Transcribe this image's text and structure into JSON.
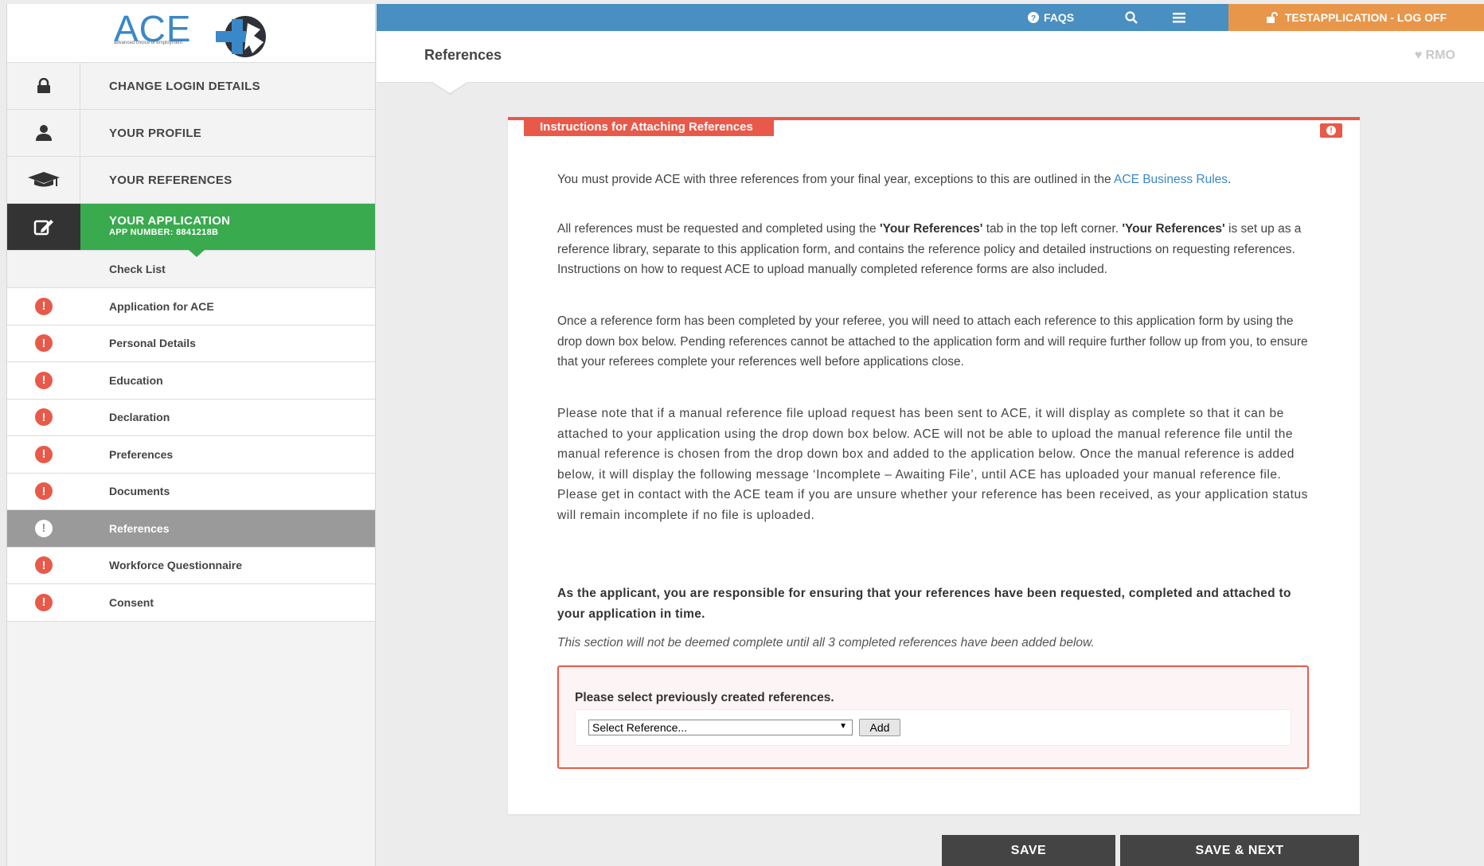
{
  "logo": {
    "text": "ACE",
    "tagline": "advanced choice of employment"
  },
  "sidebar": {
    "items": [
      {
        "label": "CHANGE LOGIN DETAILS",
        "icon": "lock-icon"
      },
      {
        "label": "YOUR PROFILE",
        "icon": "user-icon"
      },
      {
        "label": "YOUR REFERENCES",
        "icon": "graduation-cap-icon"
      },
      {
        "label": "YOUR APPLICATION",
        "sublabel": "APP NUMBER: 8841218B",
        "icon": "edit-icon"
      }
    ],
    "subitems": [
      {
        "label": "Check List",
        "status": ""
      },
      {
        "label": "Application for ACE",
        "status": "incomplete"
      },
      {
        "label": "Personal Details",
        "status": "incomplete"
      },
      {
        "label": "Education",
        "status": "incomplete"
      },
      {
        "label": "Declaration",
        "status": "incomplete"
      },
      {
        "label": "Preferences",
        "status": "incomplete"
      },
      {
        "label": "Documents",
        "status": "incomplete"
      },
      {
        "label": "References",
        "status": "incomplete"
      },
      {
        "label": "Workforce Questionnaire",
        "status": "incomplete"
      },
      {
        "label": "Consent",
        "status": "incomplete"
      }
    ],
    "alert_glyph": "!"
  },
  "topbar": {
    "faqs": "FAQS",
    "logoff": "TESTAPPLICATION - LOG OFF"
  },
  "header": {
    "title": "References",
    "rmo": "RMO"
  },
  "panel": {
    "title": "Instructions for Attaching References",
    "p1_a": "You must provide ACE with three references from your final year, exceptions to this are outlined in the ",
    "p1_link": "ACE Business Rules",
    "p1_b": ".",
    "p2_a": "All references must be requested and completed using the ",
    "p2_b1": "'Your References'",
    "p2_c": " tab in the top left corner. ",
    "p2_b2": "'Your References'",
    "p2_d": " is set up as a reference library, separate to this application form, and contains the reference policy and detailed instructions on requesting references. Instructions on how to request ACE to upload manually completed reference forms are also included.",
    "p3": "Once a reference form has been completed by your referee, you will need to attach each reference to this application form by using the drop down box below. Pending references cannot be attached to the application form and will require further follow up from you, to ensure that your referees complete your references well before applications close.",
    "p4": "Please note that if a manual reference file upload request has been sent to ACE, it will display as complete so that it can be attached to your application using the drop down box below. ACE will not be able to upload the manual reference file until the manual reference is chosen from the drop down box and added to the application below. Once the manual reference is added below, it will display the following message ‘Incomplete – Awaiting File’, until ACE has uploaded your manual reference file. Please get in contact with the ACE team if you are unsure whether your reference has been received, as your application status will remain incomplete if no file is uploaded.",
    "p5": "As the applicant, you are responsible for ensuring that your references have been requested, completed and attached to your application in time.",
    "p6": "This section will not be deemed complete until all 3 completed references have been added below.",
    "select_prompt": "Please select previously created references.",
    "select_value": "Select Reference...",
    "add_label": "Add"
  },
  "buttons": {
    "save": "SAVE",
    "save_next": "SAVE & NEXT"
  },
  "colors": {
    "topbar": "#4a8fc1",
    "logoff": "#e8964a",
    "active_green": "#3aaa4f",
    "alert_red": "#e8594a",
    "button_dark": "#444444"
  }
}
